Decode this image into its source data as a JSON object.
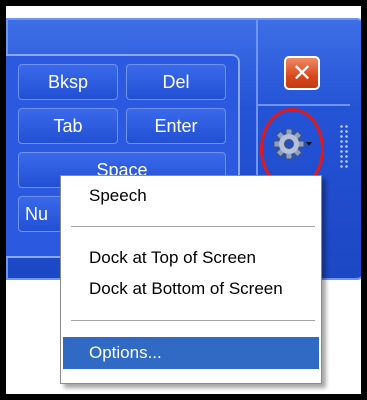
{
  "keyboard": {
    "keys": [
      {
        "label": "Bksp"
      },
      {
        "label": "Del"
      },
      {
        "label": "Tab"
      },
      {
        "label": "Enter"
      },
      {
        "label": "Space"
      },
      {
        "label": "Nu"
      }
    ],
    "close_glyph": "✕",
    "settings_icon": "gear-icon"
  },
  "menu": {
    "items": [
      {
        "label": "Speech"
      },
      {
        "label": "Dock at Top of Screen"
      },
      {
        "label": "Dock at Bottom of Screen"
      },
      {
        "label": "Options..."
      }
    ],
    "selected": "Options..."
  },
  "colors": {
    "panel_blue": "#2453d6",
    "highlight": "#316ac5",
    "close_red": "#d9481c",
    "annotation_red": "#e0191d"
  }
}
